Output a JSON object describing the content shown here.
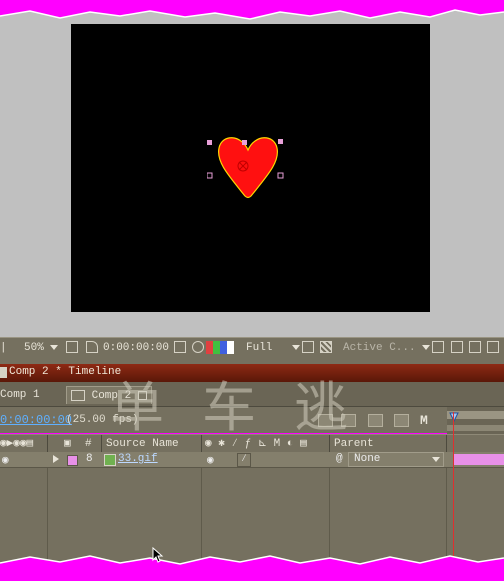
{
  "viewer_toolbar": {
    "zoom": "50%",
    "timecode": "0:00:00:00",
    "resolution": "Full",
    "camera": "Active C..."
  },
  "timeline": {
    "title": "Comp 2 * Timeline",
    "tabs": [
      "Comp 1",
      "Comp 2"
    ],
    "current_time": "0:00:00:00",
    "fps": "(25.00 fps)",
    "motion_blur_label": "M",
    "columns": {
      "number": "#",
      "source_name": "Source Name",
      "parent": "Parent",
      "time_start": "00s"
    },
    "layers": [
      {
        "index": "8",
        "source_name": "33.gif",
        "parent": "None",
        "label_color": "#e890e8"
      }
    ]
  },
  "watermark": "单车逃",
  "colors": {
    "torn_edge": "#ff00ff",
    "heart_fill": "#ff1010",
    "heart_outline": "#ffd700",
    "handle": "#e8a0d8",
    "timecode_text": "#5fb0ff",
    "track_bar": "#e890e8",
    "current_time_indicator": "#e03030",
    "timeline_title_bar": "#8e2a14"
  }
}
